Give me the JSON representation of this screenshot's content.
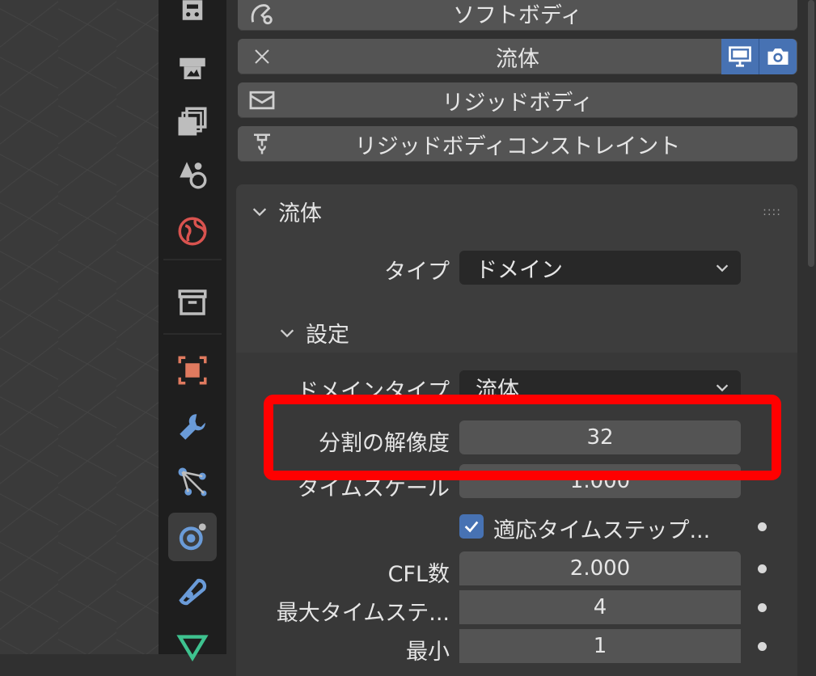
{
  "physics_buttons": [
    {
      "label": "ソフトボディ"
    },
    {
      "label": "流体"
    },
    {
      "label": "リジッドボディ"
    },
    {
      "label": "リジッドボディコンストレイント"
    }
  ],
  "fluid_panel": {
    "title": "流体",
    "type_label": "タイプ",
    "type_value": "ドメイン",
    "settings_title": "設定",
    "domain_type_label": "ドメインタイプ",
    "domain_type_value": "流体",
    "resolution_label": "分割の解像度",
    "resolution_value": "32",
    "time_scale_label": "タイムスケール",
    "time_scale_value": "1.000",
    "adaptive_label": "適応タイムステップ...",
    "cfl_label": "CFL数",
    "cfl_value": "2.000",
    "max_label": "最大タイムステ...",
    "max_value": "4",
    "min_label": "最小",
    "min_value": "1"
  },
  "colors": {
    "accent": "#4772b3",
    "highlight": "#ff0000"
  }
}
